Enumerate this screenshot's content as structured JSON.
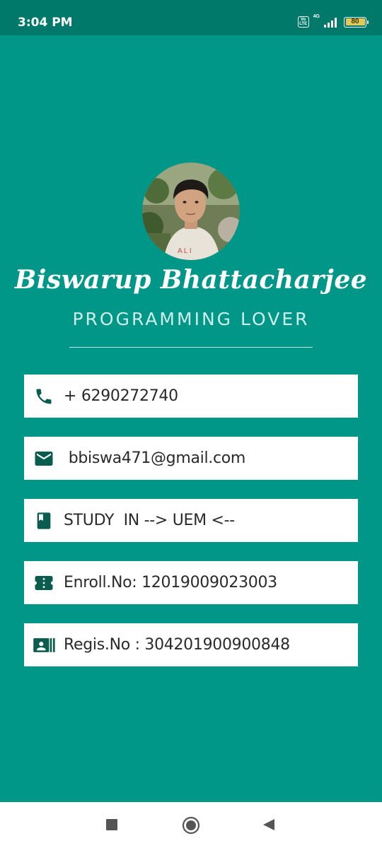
{
  "status_bar": {
    "time": "3:04 PM",
    "volte_label": "Vo LTE",
    "network_label": "4G",
    "battery_level": "80"
  },
  "profile": {
    "name": "Biswarup Bhattacharjee",
    "tagline": "PROGRAMMING LOVER"
  },
  "cards": [
    {
      "icon": "phone-icon",
      "text": "+ 6290272740"
    },
    {
      "icon": "email-icon",
      "text": " bbiswa471@gmail.com"
    },
    {
      "icon": "book-icon",
      "text": "STUDY  IN --> UEM <--"
    },
    {
      "icon": "ticket-icon",
      "text": "Enroll.No: 12019009023003"
    },
    {
      "icon": "id-card-icon",
      "text": "Regis.No : 304201900900848"
    }
  ],
  "colors": {
    "background": "#009688",
    "status_bar": "#00786a",
    "icon": "#0a5c4f",
    "card": "#ffffff"
  }
}
